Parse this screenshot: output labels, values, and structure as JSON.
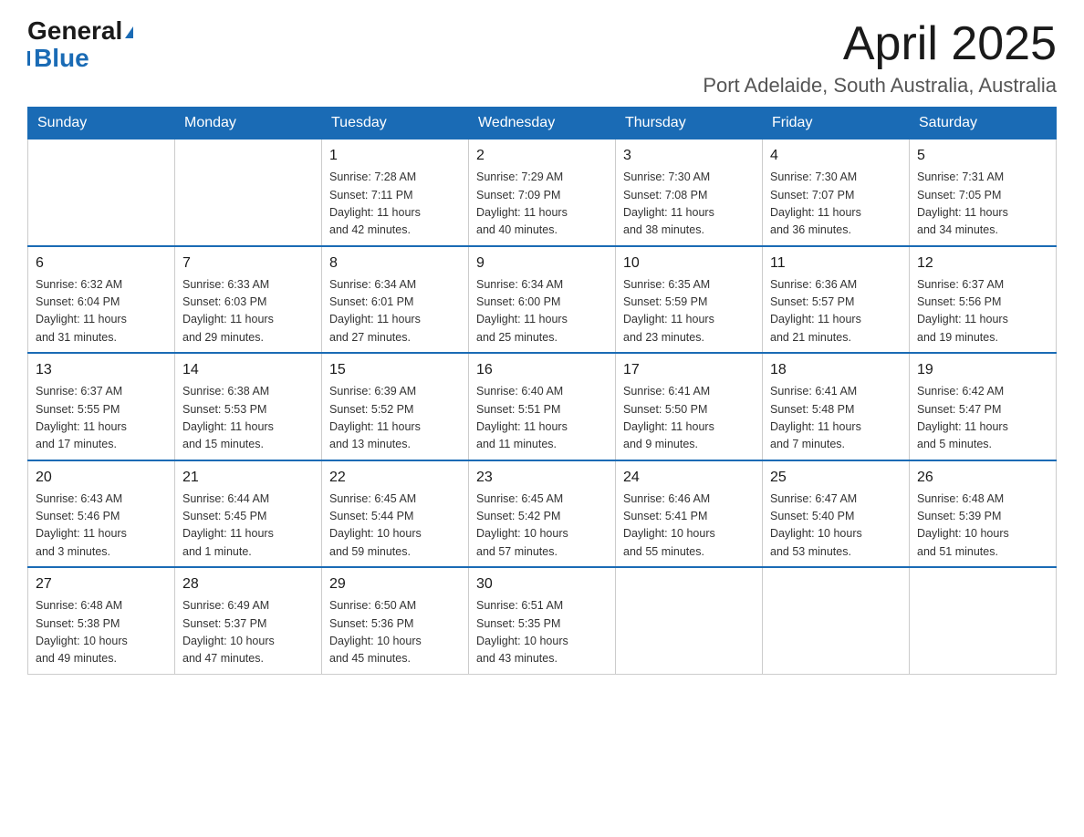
{
  "header": {
    "logo_general": "General",
    "logo_blue": "Blue",
    "month_title": "April 2025",
    "location": "Port Adelaide, South Australia, Australia"
  },
  "weekdays": [
    "Sunday",
    "Monday",
    "Tuesday",
    "Wednesday",
    "Thursday",
    "Friday",
    "Saturday"
  ],
  "weeks": [
    [
      {
        "day": "",
        "info": ""
      },
      {
        "day": "",
        "info": ""
      },
      {
        "day": "1",
        "info": "Sunrise: 7:28 AM\nSunset: 7:11 PM\nDaylight: 11 hours\nand 42 minutes."
      },
      {
        "day": "2",
        "info": "Sunrise: 7:29 AM\nSunset: 7:09 PM\nDaylight: 11 hours\nand 40 minutes."
      },
      {
        "day": "3",
        "info": "Sunrise: 7:30 AM\nSunset: 7:08 PM\nDaylight: 11 hours\nand 38 minutes."
      },
      {
        "day": "4",
        "info": "Sunrise: 7:30 AM\nSunset: 7:07 PM\nDaylight: 11 hours\nand 36 minutes."
      },
      {
        "day": "5",
        "info": "Sunrise: 7:31 AM\nSunset: 7:05 PM\nDaylight: 11 hours\nand 34 minutes."
      }
    ],
    [
      {
        "day": "6",
        "info": "Sunrise: 6:32 AM\nSunset: 6:04 PM\nDaylight: 11 hours\nand 31 minutes."
      },
      {
        "day": "7",
        "info": "Sunrise: 6:33 AM\nSunset: 6:03 PM\nDaylight: 11 hours\nand 29 minutes."
      },
      {
        "day": "8",
        "info": "Sunrise: 6:34 AM\nSunset: 6:01 PM\nDaylight: 11 hours\nand 27 minutes."
      },
      {
        "day": "9",
        "info": "Sunrise: 6:34 AM\nSunset: 6:00 PM\nDaylight: 11 hours\nand 25 minutes."
      },
      {
        "day": "10",
        "info": "Sunrise: 6:35 AM\nSunset: 5:59 PM\nDaylight: 11 hours\nand 23 minutes."
      },
      {
        "day": "11",
        "info": "Sunrise: 6:36 AM\nSunset: 5:57 PM\nDaylight: 11 hours\nand 21 minutes."
      },
      {
        "day": "12",
        "info": "Sunrise: 6:37 AM\nSunset: 5:56 PM\nDaylight: 11 hours\nand 19 minutes."
      }
    ],
    [
      {
        "day": "13",
        "info": "Sunrise: 6:37 AM\nSunset: 5:55 PM\nDaylight: 11 hours\nand 17 minutes."
      },
      {
        "day": "14",
        "info": "Sunrise: 6:38 AM\nSunset: 5:53 PM\nDaylight: 11 hours\nand 15 minutes."
      },
      {
        "day": "15",
        "info": "Sunrise: 6:39 AM\nSunset: 5:52 PM\nDaylight: 11 hours\nand 13 minutes."
      },
      {
        "day": "16",
        "info": "Sunrise: 6:40 AM\nSunset: 5:51 PM\nDaylight: 11 hours\nand 11 minutes."
      },
      {
        "day": "17",
        "info": "Sunrise: 6:41 AM\nSunset: 5:50 PM\nDaylight: 11 hours\nand 9 minutes."
      },
      {
        "day": "18",
        "info": "Sunrise: 6:41 AM\nSunset: 5:48 PM\nDaylight: 11 hours\nand 7 minutes."
      },
      {
        "day": "19",
        "info": "Sunrise: 6:42 AM\nSunset: 5:47 PM\nDaylight: 11 hours\nand 5 minutes."
      }
    ],
    [
      {
        "day": "20",
        "info": "Sunrise: 6:43 AM\nSunset: 5:46 PM\nDaylight: 11 hours\nand 3 minutes."
      },
      {
        "day": "21",
        "info": "Sunrise: 6:44 AM\nSunset: 5:45 PM\nDaylight: 11 hours\nand 1 minute."
      },
      {
        "day": "22",
        "info": "Sunrise: 6:45 AM\nSunset: 5:44 PM\nDaylight: 10 hours\nand 59 minutes."
      },
      {
        "day": "23",
        "info": "Sunrise: 6:45 AM\nSunset: 5:42 PM\nDaylight: 10 hours\nand 57 minutes."
      },
      {
        "day": "24",
        "info": "Sunrise: 6:46 AM\nSunset: 5:41 PM\nDaylight: 10 hours\nand 55 minutes."
      },
      {
        "day": "25",
        "info": "Sunrise: 6:47 AM\nSunset: 5:40 PM\nDaylight: 10 hours\nand 53 minutes."
      },
      {
        "day": "26",
        "info": "Sunrise: 6:48 AM\nSunset: 5:39 PM\nDaylight: 10 hours\nand 51 minutes."
      }
    ],
    [
      {
        "day": "27",
        "info": "Sunrise: 6:48 AM\nSunset: 5:38 PM\nDaylight: 10 hours\nand 49 minutes."
      },
      {
        "day": "28",
        "info": "Sunrise: 6:49 AM\nSunset: 5:37 PM\nDaylight: 10 hours\nand 47 minutes."
      },
      {
        "day": "29",
        "info": "Sunrise: 6:50 AM\nSunset: 5:36 PM\nDaylight: 10 hours\nand 45 minutes."
      },
      {
        "day": "30",
        "info": "Sunrise: 6:51 AM\nSunset: 5:35 PM\nDaylight: 10 hours\nand 43 minutes."
      },
      {
        "day": "",
        "info": ""
      },
      {
        "day": "",
        "info": ""
      },
      {
        "day": "",
        "info": ""
      }
    ]
  ]
}
